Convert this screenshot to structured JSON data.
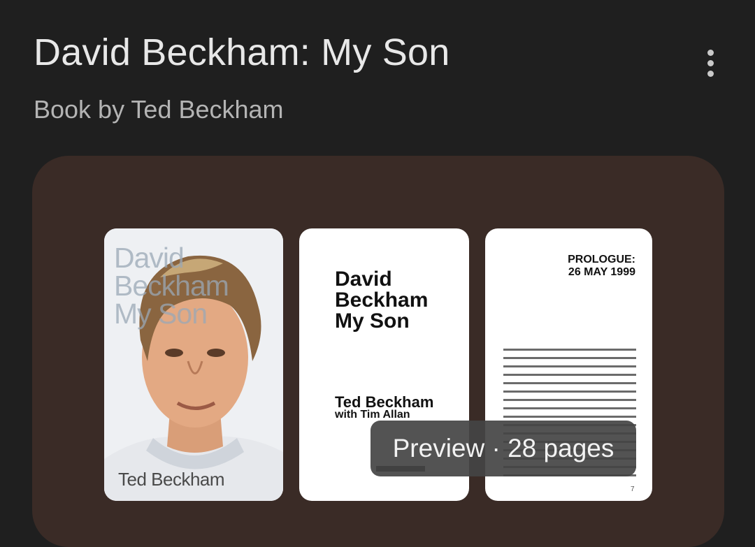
{
  "header": {
    "title": "David Beckham: My Son",
    "subtitle": "Book by Ted Beckham"
  },
  "more_icon": "more-vert-icon",
  "gallery": {
    "cover": {
      "title_lines": [
        "David",
        "Beckham",
        "My Son"
      ],
      "author": "Ted Beckham"
    },
    "title_page": {
      "title": "David\nBeckham\nMy Son",
      "author": "Ted Beckham",
      "with": "with Tim Allan"
    },
    "prologue_page": {
      "heading": "PROLOGUE:\n26 MAY 1999",
      "page_number": "7"
    },
    "preview_label": "Preview · 28 pages"
  },
  "colors": {
    "background": "#1f1f1f",
    "card": "#3a2b26",
    "badge": "#444444"
  }
}
